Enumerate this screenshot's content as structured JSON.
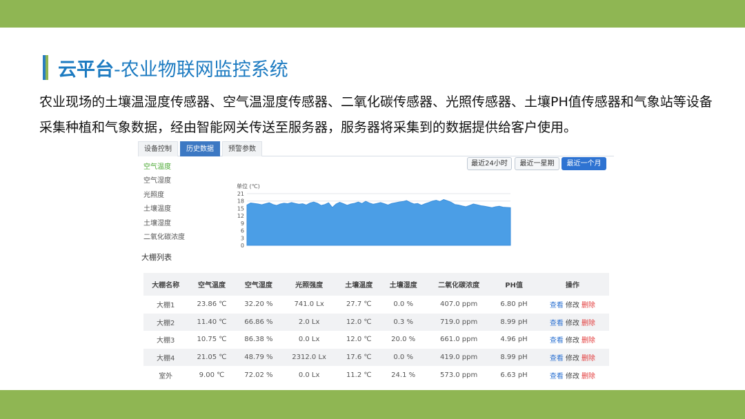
{
  "slide": {
    "title_prefix": "云平台",
    "title_main": "-农业物联网监控系统",
    "description": "农业现场的土壤温湿度传感器、空气温湿度传感器、二氧化碳传感器、光照传感器、土壤PH值传感器和气象站等设备采集种植和气象数据，经由智能网关传送至服务器，服务器将采集到的数据提供给客户使用。"
  },
  "tabs": [
    {
      "label": "设备控制",
      "active": false
    },
    {
      "label": "历史数据",
      "active": true
    },
    {
      "label": "预警参数",
      "active": false
    }
  ],
  "sidebar": {
    "items": [
      {
        "label": "空气温度",
        "active": true
      },
      {
        "label": "空气湿度",
        "active": false
      },
      {
        "label": "光照度",
        "active": false
      },
      {
        "label": "土壤温度",
        "active": false
      },
      {
        "label": "土壤湿度",
        "active": false
      },
      {
        "label": "二氧化碳浓度",
        "active": false
      }
    ]
  },
  "range_buttons": [
    {
      "label": "最近24小时",
      "active": false
    },
    {
      "label": "最近一星期",
      "active": false
    },
    {
      "label": "最近一个月",
      "active": true
    }
  ],
  "chart_data": {
    "type": "area",
    "unit_label": "单位 (℃)",
    "ylim": [
      0,
      21
    ],
    "yticks": [
      21,
      18,
      15,
      12,
      9,
      6,
      3,
      0
    ],
    "values": [
      16.4,
      17.2,
      17.0,
      16.8,
      16.5,
      16.9,
      17.3,
      16.6,
      16.2,
      16.8,
      17.1,
      16.9,
      17.4,
      17.0,
      16.7,
      16.9,
      16.4,
      17.2,
      17.6,
      17.1,
      16.2,
      16.6,
      17.3,
      15.4,
      16.8,
      17.5,
      16.9,
      16.3,
      16.8,
      17.1,
      17.6,
      17.0,
      17.9,
      17.2,
      16.7,
      17.0,
      17.4,
      16.9,
      16.4,
      17.0,
      17.3,
      17.6,
      17.8,
      18.2,
      17.4,
      16.8,
      17.0,
      16.3,
      16.9,
      17.4,
      18.0,
      18.3,
      17.8,
      18.6,
      18.1,
      17.5,
      16.6,
      16.4,
      16.0,
      15.7,
      16.2,
      16.8,
      16.5,
      16.1,
      15.9,
      15.6,
      15.3,
      15.7,
      15.9,
      15.5,
      15.4,
      15.3
    ],
    "fill_color": "#4b9ee6",
    "grid": true,
    "legend": "none"
  },
  "list": {
    "title": "大棚列表",
    "columns": [
      "大棚名称",
      "空气温度",
      "空气湿度",
      "光照强度",
      "土壤温度",
      "土壤湿度",
      "二氧化碳浓度",
      "PH值",
      "操作"
    ],
    "rows": [
      {
        "name": "大棚1",
        "air_temp": "23.86 ℃",
        "air_hum": "32.20 %",
        "light": "741.0 Lx",
        "soil_temp": "27.7 ℃",
        "soil_hum": "0.0 %",
        "co2": "407.0 ppm",
        "ph": "6.80 pH"
      },
      {
        "name": "大棚2",
        "air_temp": "11.40 ℃",
        "air_hum": "66.86 %",
        "light": "2.0 Lx",
        "soil_temp": "12.0 ℃",
        "soil_hum": "0.3 %",
        "co2": "719.0 ppm",
        "ph": "8.99 pH"
      },
      {
        "name": "大棚3",
        "air_temp": "10.75 ℃",
        "air_hum": "86.38 %",
        "light": "0.0 Lx",
        "soil_temp": "12.0 ℃",
        "soil_hum": "20.0 %",
        "co2": "661.0 ppm",
        "ph": "4.96 pH"
      },
      {
        "name": "大棚4",
        "air_temp": "21.05 ℃",
        "air_hum": "48.79 %",
        "light": "2312.0 Lx",
        "soil_temp": "17.6 ℃",
        "soil_hum": "0.0 %",
        "co2": "419.0 ppm",
        "ph": "8.99 pH"
      },
      {
        "name": "室外",
        "air_temp": "9.00 ℃",
        "air_hum": "72.02 %",
        "light": "0.0 Lx",
        "soil_temp": "11.2 ℃",
        "soil_hum": "24.1 %",
        "co2": "573.0 ppm",
        "ph": "6.63 pH"
      }
    ],
    "actions": {
      "view": "查看",
      "edit": "修改",
      "delete": "删除"
    }
  },
  "colors": {
    "band": "#8fb653",
    "title_blue": "#1d7bc1",
    "active_tab": "#3c78c3",
    "delete_red": "#e23b3b"
  }
}
